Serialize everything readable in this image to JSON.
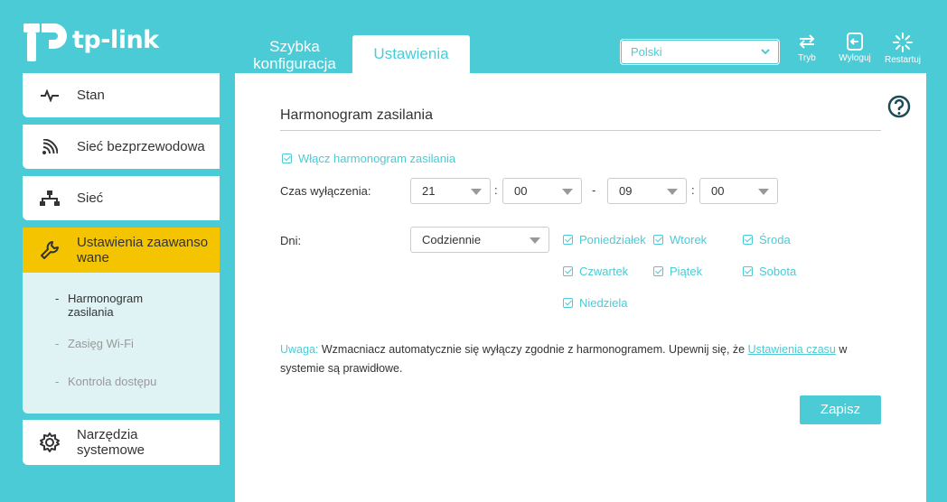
{
  "header": {
    "logo_text": "tp-link",
    "tabs": [
      {
        "label_line1": "Szybka",
        "label_line2": "konfiguracja"
      },
      {
        "label": "Ustawienia"
      }
    ],
    "language": "Polski",
    "buttons": [
      {
        "label": "Tryb",
        "icon": "mode-swap-icon"
      },
      {
        "label": "Wyloguj",
        "icon": "logout-icon"
      },
      {
        "label": "Restartuj",
        "icon": "restart-icon"
      }
    ]
  },
  "sidebar": {
    "items": [
      {
        "label": "Stan",
        "icon": "pulse-icon"
      },
      {
        "label": "Sieć bezprzewodowa",
        "icon": "wireless-icon"
      },
      {
        "label": "Sieć",
        "icon": "network-icon"
      },
      {
        "label_line1": "Ustawienia zaawanso",
        "label_line2": "wane",
        "icon": "wrench-icon"
      },
      {
        "label_line1": "Narzędzia",
        "label_line2": "systemowe",
        "icon": "gear-icon"
      }
    ],
    "submenu": [
      {
        "label_line1": "Harmonogram",
        "label_line2": "zasilania"
      },
      {
        "label": "Zasięg Wi-Fi"
      },
      {
        "label": "Kontrola dostępu"
      }
    ],
    "submenu_dash": "-"
  },
  "main": {
    "title": "Harmonogram zasilania",
    "enable_label": "Włącz harmonogram zasilania",
    "off_time_label": "Czas wyłączenia:",
    "time": {
      "start_hour": "21",
      "start_min": "00",
      "end_hour": "09",
      "end_min": "00",
      "colon": ":",
      "dash": "-"
    },
    "days_label": "Dni:",
    "days_mode": "Codziennie",
    "days": [
      "Poniedziałek",
      "Wtorek",
      "Środa",
      "Czwartek",
      "Piątek",
      "Sobota",
      "Niedziela"
    ],
    "note_key": "Uwaga:",
    "note_text": "Wzmacniacz automatycznie się wyłączy zgodnie z harmonogramem. Upewnij się, że",
    "note_link": "Ustawienia czasu",
    "note_end": "w systemie są prawidłowe.",
    "save_label": "Zapisz"
  },
  "colors": {
    "accent": "#4acbd6",
    "active_nav": "#f5c400",
    "submenu_bg": "#dff3f5"
  }
}
